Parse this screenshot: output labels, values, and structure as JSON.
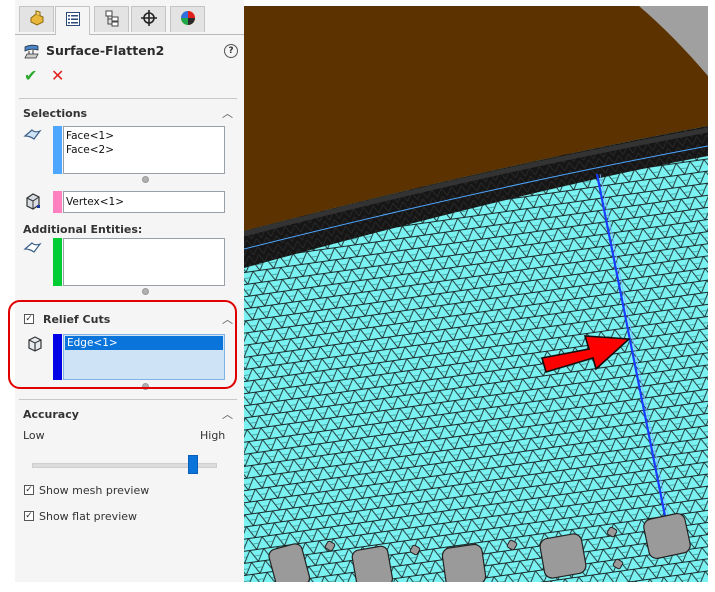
{
  "panel": {
    "tabs": [
      {
        "name": "featuremanager",
        "icon": "part-icon"
      },
      {
        "name": "propertymanager",
        "icon": "property-list-icon",
        "active": true
      },
      {
        "name": "configurationmanager",
        "icon": "configuration-tree-icon"
      },
      {
        "name": "dimxpertmanager",
        "icon": "crosshair-icon"
      },
      {
        "name": "displaymanager",
        "icon": "appearance-pie-icon"
      }
    ],
    "title": "Surface-Flatten2",
    "help_icon": "?",
    "ok_icon": "✔",
    "cancel_icon": "✕",
    "selections": {
      "title": "Selections",
      "faces": [
        "Face<1>",
        "Face<2>"
      ],
      "faces_color": "#4da6ff",
      "vertex": "Vertex<1>",
      "vertex_color": "#ff80c0",
      "additional_label": "Additional Entities:",
      "additional_items": [],
      "additional_color": "#00cc33"
    },
    "relief_cuts": {
      "title": "Relief Cuts",
      "checked": true,
      "items": [
        "Edge<1>"
      ],
      "color": "#0000e6",
      "highlight_color": "#0a74da",
      "frame_color": "#e00000"
    },
    "accuracy": {
      "title": "Accuracy",
      "low_label": "Low",
      "high_label": "High",
      "slider_value_fraction": 0.88,
      "slider_color": "#0a74da"
    },
    "options": [
      {
        "label": "Show mesh preview",
        "checked": true
      },
      {
        "label": "Show flat preview",
        "checked": true
      }
    ]
  },
  "viewport": {
    "top_surface_color": "#5c3300",
    "mesh_color": "#7af2f2",
    "edge_color": "#111111",
    "relief_edge_color": "#1a3cff",
    "arrow_color": "#ff0000",
    "hole_color": "#9a9a9a"
  }
}
